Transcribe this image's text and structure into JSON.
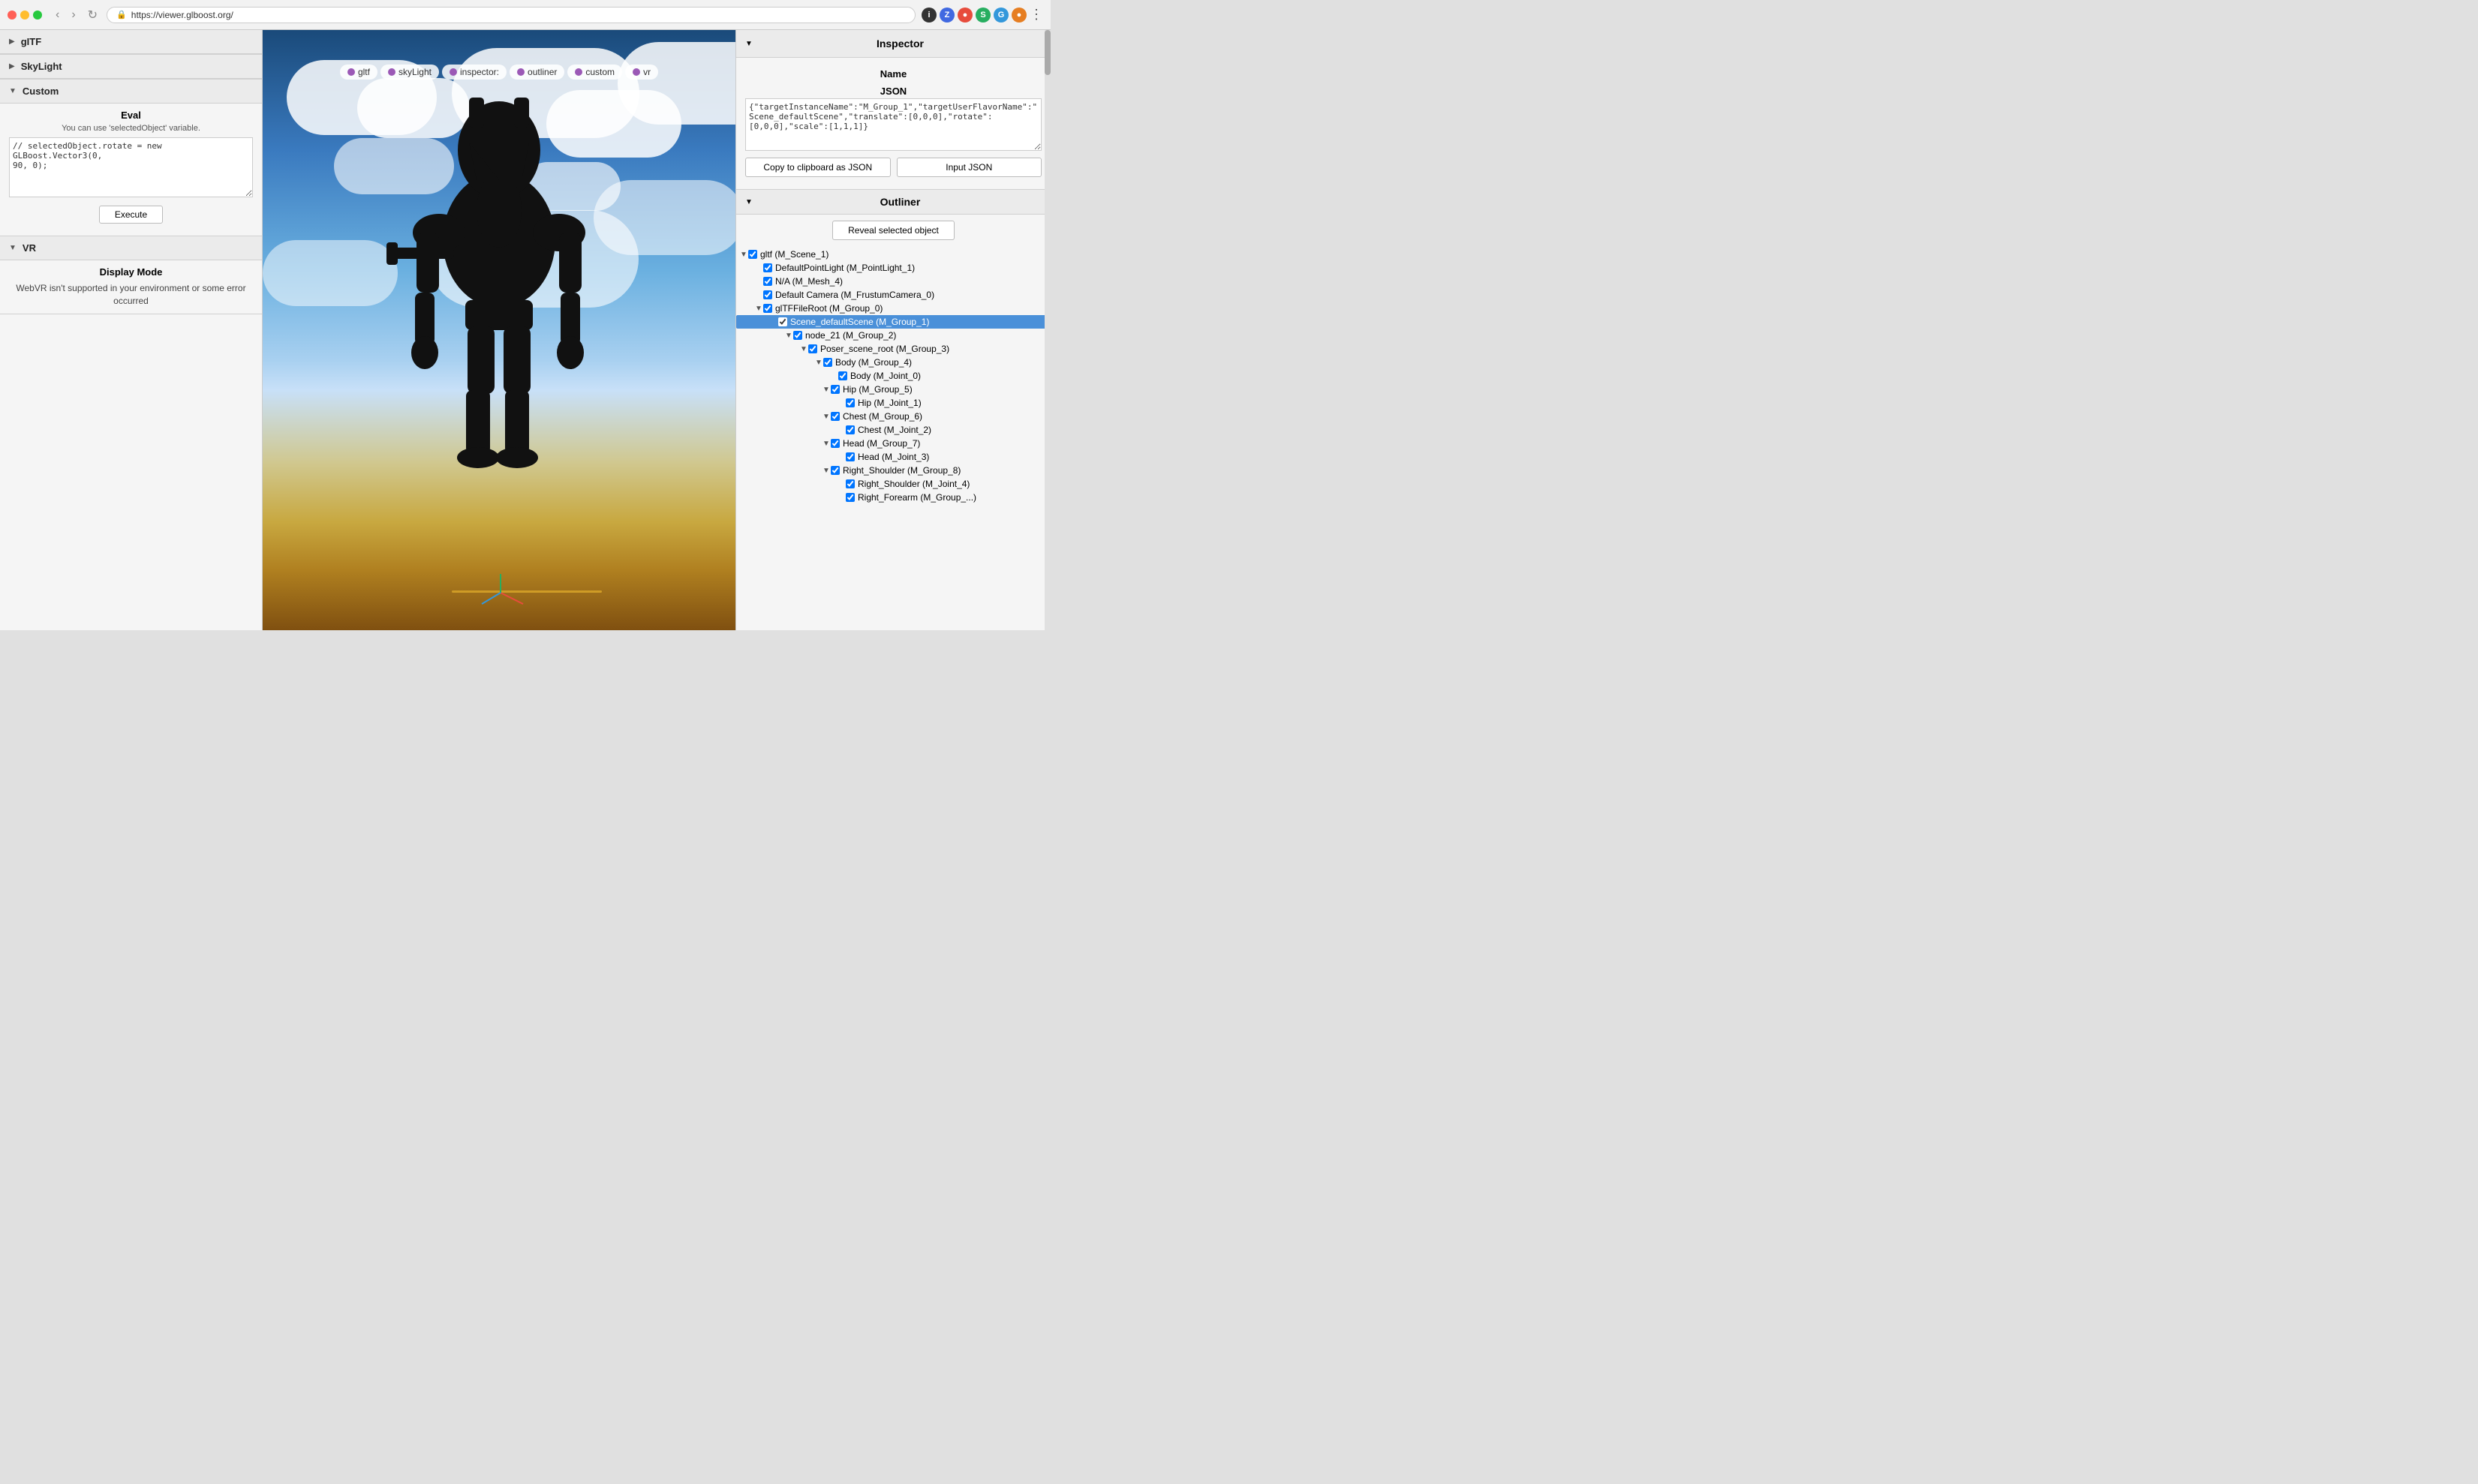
{
  "browser": {
    "url": "https://viewer.glboost.org/",
    "lock_icon": "🔒"
  },
  "tabs": [
    {
      "label": "gltf",
      "dot_color": "#9b59b6",
      "active": false
    },
    {
      "label": "skyLight",
      "dot_color": "#9b59b6",
      "active": false
    },
    {
      "label": "inspector:",
      "dot_color": "#9b59b6",
      "active": false
    },
    {
      "label": "outliner",
      "dot_color": "#9b59b6",
      "active": false
    },
    {
      "label": "custom",
      "dot_color": "#9b59b6",
      "active": false
    },
    {
      "label": "vr",
      "dot_color": "#9b59b6",
      "active": false
    }
  ],
  "left_panel": {
    "sections": [
      {
        "id": "gltf",
        "title": "gITF",
        "collapsed": true,
        "arrow": "▶"
      },
      {
        "id": "skylight",
        "title": "SkyLight",
        "collapsed": true,
        "arrow": "▶"
      },
      {
        "id": "custom",
        "title": "Custom",
        "collapsed": false,
        "arrow": "▼",
        "content": {
          "eval_label": "Eval",
          "eval_hint": "You can use 'selectedObject' variable.",
          "eval_placeholder": "// selectedObject.rotate = new GLBoost.Vector3(0,\n90, 0);",
          "execute_label": "Execute"
        }
      },
      {
        "id": "vr",
        "title": "VR",
        "collapsed": false,
        "arrow": "▼",
        "content": {
          "display_mode_label": "Display Mode",
          "display_mode_text": "WebVR isn't supported in your environment or some error occurred"
        }
      }
    ]
  },
  "right_panel": {
    "inspector": {
      "title": "Inspector",
      "arrow": "▼",
      "name_label": "Name",
      "json_label": "JSON",
      "json_value": "{\"targetInstanceName\":\"M_Group_1\",\"targetUserFlavorName\":\"Scene_defaultScene\",\"translate\":[0,0,0],\"rotate\":[0,0,0],\"scale\":[1,1,1]}",
      "copy_btn": "Copy to clipboard as JSON",
      "input_btn": "Input JSON"
    },
    "outliner": {
      "title": "Outliner",
      "arrow": "▼",
      "reveal_btn": "Reveal selected object",
      "tree": [
        {
          "id": "gltf_root",
          "label": "gltf (M_Scene_1)",
          "indent": 0,
          "toggle": "▼",
          "checked": true,
          "selected": false
        },
        {
          "id": "point_light",
          "label": "DefaultPointLight (M_PointLight_1)",
          "indent": 1,
          "toggle": "",
          "checked": true,
          "selected": false
        },
        {
          "id": "mesh_4",
          "label": "N/A (M_Mesh_4)",
          "indent": 1,
          "toggle": "",
          "checked": true,
          "selected": false
        },
        {
          "id": "camera",
          "label": "Default Camera (M_FrustumCamera_0)",
          "indent": 1,
          "toggle": "",
          "checked": true,
          "selected": false
        },
        {
          "id": "gltf_file_root",
          "label": "glTFFileRoot (M_Group_0)",
          "indent": 1,
          "toggle": "▼",
          "checked": true,
          "selected": false
        },
        {
          "id": "scene_default",
          "label": "Scene_defaultScene (M_Group_1)",
          "indent": 2,
          "toggle": "",
          "checked": true,
          "selected": true
        },
        {
          "id": "node_21",
          "label": "node_21 (M_Group_2)",
          "indent": 3,
          "toggle": "▼",
          "checked": true,
          "selected": false
        },
        {
          "id": "poser_root",
          "label": "Poser_scene_root (M_Group_3)",
          "indent": 4,
          "toggle": "▼",
          "checked": true,
          "selected": false
        },
        {
          "id": "body_group",
          "label": "Body (M_Group_4)",
          "indent": 5,
          "toggle": "▼",
          "checked": true,
          "selected": false
        },
        {
          "id": "body_joint",
          "label": "Body (M_Joint_0)",
          "indent": 6,
          "toggle": "",
          "checked": true,
          "selected": false
        },
        {
          "id": "hip_group",
          "label": "Hip (M_Group_5)",
          "indent": 6,
          "toggle": "▼",
          "checked": true,
          "selected": false
        },
        {
          "id": "hip_joint",
          "label": "Hip (M_Joint_1)",
          "indent": 7,
          "toggle": "",
          "checked": true,
          "selected": false
        },
        {
          "id": "chest_group",
          "label": "Chest (M_Group_6)",
          "indent": 6,
          "toggle": "▼",
          "checked": true,
          "selected": false
        },
        {
          "id": "chest_joint",
          "label": "Chest (M_Joint_2)",
          "indent": 7,
          "toggle": "",
          "checked": true,
          "selected": false
        },
        {
          "id": "head_group",
          "label": "Head (M_Group_7)",
          "indent": 6,
          "toggle": "▼",
          "checked": true,
          "selected": false
        },
        {
          "id": "head_joint",
          "label": "Head (M_Joint_3)",
          "indent": 7,
          "toggle": "",
          "checked": true,
          "selected": false
        },
        {
          "id": "right_shoulder_group",
          "label": "Right_Shoulder (M_Group_8)",
          "indent": 6,
          "toggle": "▼",
          "checked": true,
          "selected": false
        },
        {
          "id": "right_shoulder_joint",
          "label": "Right_Shoulder (M_Joint_4)",
          "indent": 7,
          "toggle": "",
          "checked": true,
          "selected": false
        },
        {
          "id": "right_forearm_group",
          "label": "Right_Forearm (M_Group_...)",
          "indent": 7,
          "toggle": "",
          "checked": true,
          "selected": false
        }
      ]
    }
  }
}
